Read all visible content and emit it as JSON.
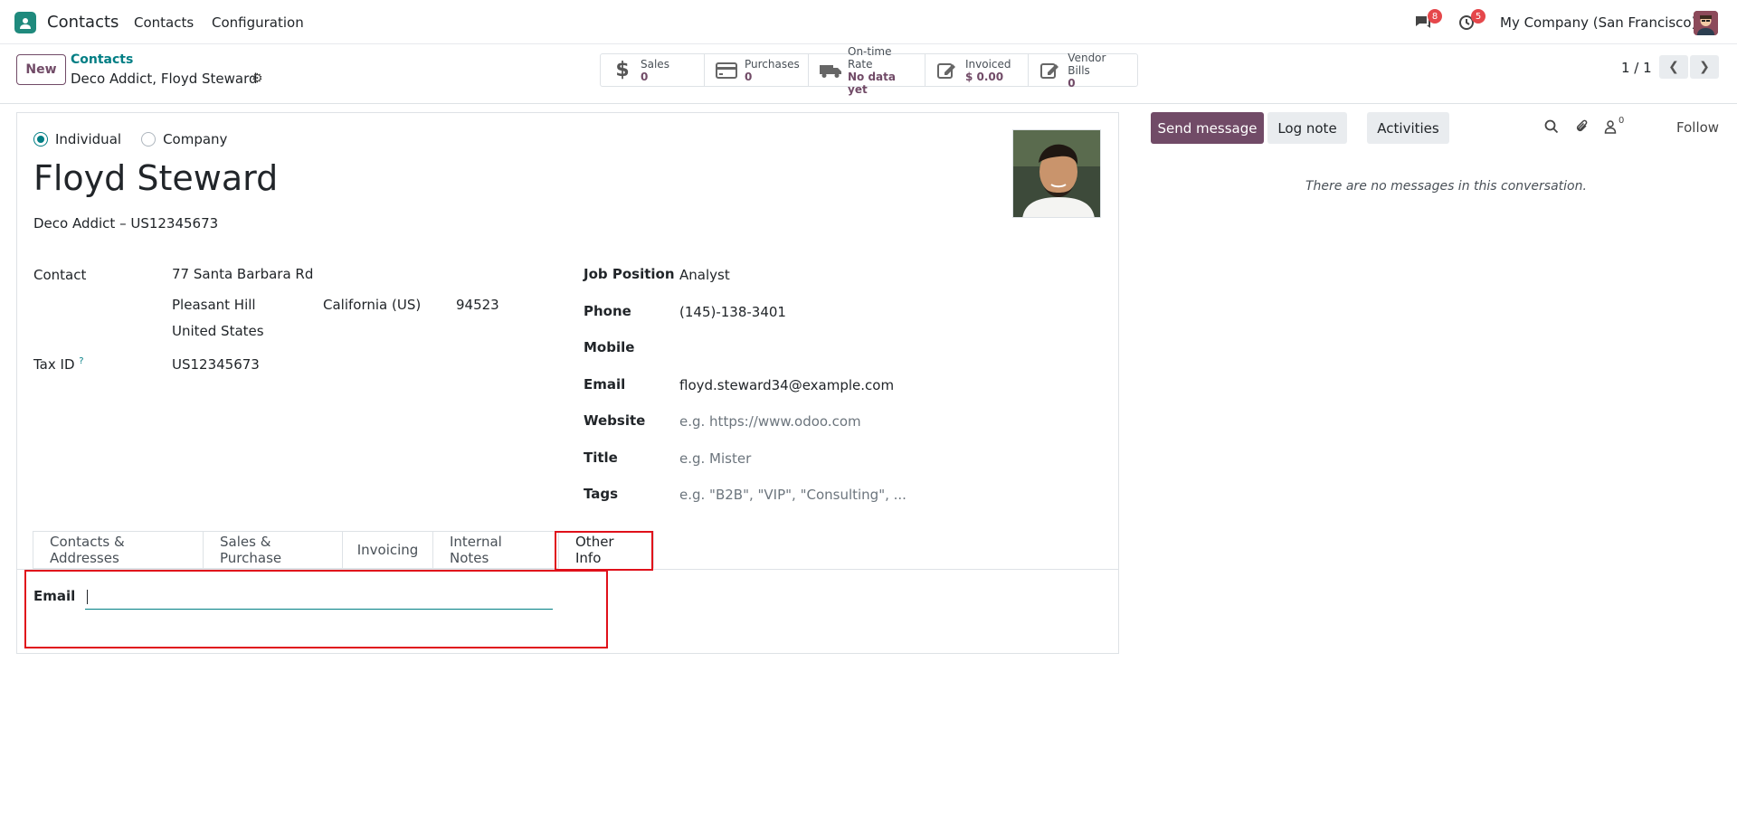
{
  "navbar": {
    "app_name": "Contacts",
    "menu": [
      "Contacts",
      "Configuration"
    ],
    "messages_count": "8",
    "activities_count": "5",
    "company": "My Company (San Francisco)"
  },
  "control": {
    "new_label": "New",
    "breadcrumb_parent": "Contacts",
    "breadcrumb_current": "Deco Addict, Floyd Steward",
    "pager": "1 / 1",
    "stats": [
      {
        "label": "Sales",
        "value": "0",
        "icon": "dollar-icon"
      },
      {
        "label": "Purchases",
        "value": "0",
        "icon": "credit-card-icon"
      },
      {
        "label": "On-time Rate",
        "value": "No data yet",
        "icon": "truck-icon"
      },
      {
        "label": "Invoiced",
        "value": "$ 0.00",
        "icon": "pencil-square-icon"
      },
      {
        "label": "Vendor Bills",
        "value": "0",
        "icon": "pencil-square-icon"
      }
    ]
  },
  "form": {
    "type_individual": "Individual",
    "type_company": "Company",
    "name": "Floyd Steward",
    "subtitle": "Deco Addict – US12345673",
    "contact_label": "Contact",
    "street": "77 Santa Barbara Rd",
    "city": "Pleasant Hill",
    "state": "California (US)",
    "zip": "94523",
    "country": "United States",
    "tax_label": "Tax ID",
    "tax_help": "?",
    "tax_value": "US12345673",
    "job_label": "Job Position",
    "job_value": "Analyst",
    "phone_label": "Phone",
    "phone_value": "(145)-138-3401",
    "mobile_label": "Mobile",
    "email_label": "Email",
    "email_value": "floyd.steward34@example.com",
    "website_label": "Website",
    "website_placeholder": "e.g. https://www.odoo.com",
    "title_label": "Title",
    "title_placeholder": "e.g. Mister",
    "tags_label": "Tags",
    "tags_placeholder": "e.g. \"B2B\", \"VIP\", \"Consulting\", ..."
  },
  "tabs": [
    "Contacts & Addresses",
    "Sales & Purchase",
    "Invoicing",
    "Internal Notes",
    "Other Info"
  ],
  "other_info": {
    "email_label": "Email",
    "email_value": ""
  },
  "chatter": {
    "send_message": "Send message",
    "log_note": "Log note",
    "activities": "Activities",
    "followers_count": "0",
    "follow": "Follow",
    "empty_text": "There are no messages in this conversation."
  },
  "colors": {
    "primary": "#714b67",
    "link": "#017e84",
    "highlight": "#e0101a",
    "badge": "#e5474b"
  }
}
